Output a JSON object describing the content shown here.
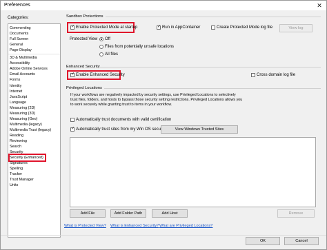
{
  "window": {
    "title": "Preferences",
    "close_glyph": "✕"
  },
  "categories": {
    "label": "Categories:",
    "items": [
      "Commenting",
      "Documents",
      "Full Screen",
      "General",
      "Page Display",
      "3D & Multimedia",
      "Accessibility",
      "Adobe Online Services",
      "Email Accounts",
      "Forms",
      "Identity",
      "Internet",
      "JavaScript",
      "Language",
      "Measuring (2D)",
      "Measuring (3D)",
      "Measuring (Geo)",
      "Multimedia (legacy)",
      "Multimedia Trust (legacy)",
      "Reading",
      "Reviewing",
      "Search",
      "Security",
      "Security (Enhanced)",
      "Signatures",
      "Spelling",
      "Tracker",
      "Trust Manager",
      "Units"
    ],
    "selected": "Security (Enhanced)"
  },
  "sandbox": {
    "heading": "Sandbox Protections",
    "protected_mode_label": "Enable Protected Mode at startup",
    "protected_mode_checked": true,
    "appcontainer_label": "Run in AppContainer",
    "appcontainer_checked": true,
    "log_file_label": "Create Protected Mode log file",
    "log_file_checked": false,
    "view_log_label": "View log",
    "protected_view_label": "Protected View",
    "pv_options": [
      "Off",
      "Files from potentially unsafe locations",
      "All files"
    ],
    "pv_selected": "Off"
  },
  "enhanced": {
    "heading": "Enhanced Security",
    "enable_label": "Enable Enhanced Security",
    "enable_checked": true,
    "cross_domain_label": "Cross domain log file",
    "cross_domain_checked": false
  },
  "privileged": {
    "heading": "Privileged Locations",
    "description": "If your workflows are negatively impacted by security settings, use Privileged Locations to selectively trust files, folders, and hosts to bypass those security setting restrictions. Privileged Locations allows you to work securely while granting trust to items in your workflow.",
    "trust_certified_label": "Automatically trust documents with valid certification",
    "trust_certified_checked": false,
    "trust_win_zones_label": "Automatically trust sites from my Win OS security zones",
    "trust_win_zones_checked": true,
    "view_trusted_sites_label": "View Windows Trusted Sites",
    "add_file_label": "Add File",
    "add_folder_label": "Add Folder Path",
    "add_host_label": "Add Host",
    "remove_label": "Remove"
  },
  "links": {
    "protected_view": "What is Protected View?",
    "enhanced_security": "What is Enhanced Security?",
    "privileged_locations": "What are Privileged Locations?"
  },
  "footer": {
    "ok_label": "OK",
    "cancel_label": "Cancel"
  }
}
